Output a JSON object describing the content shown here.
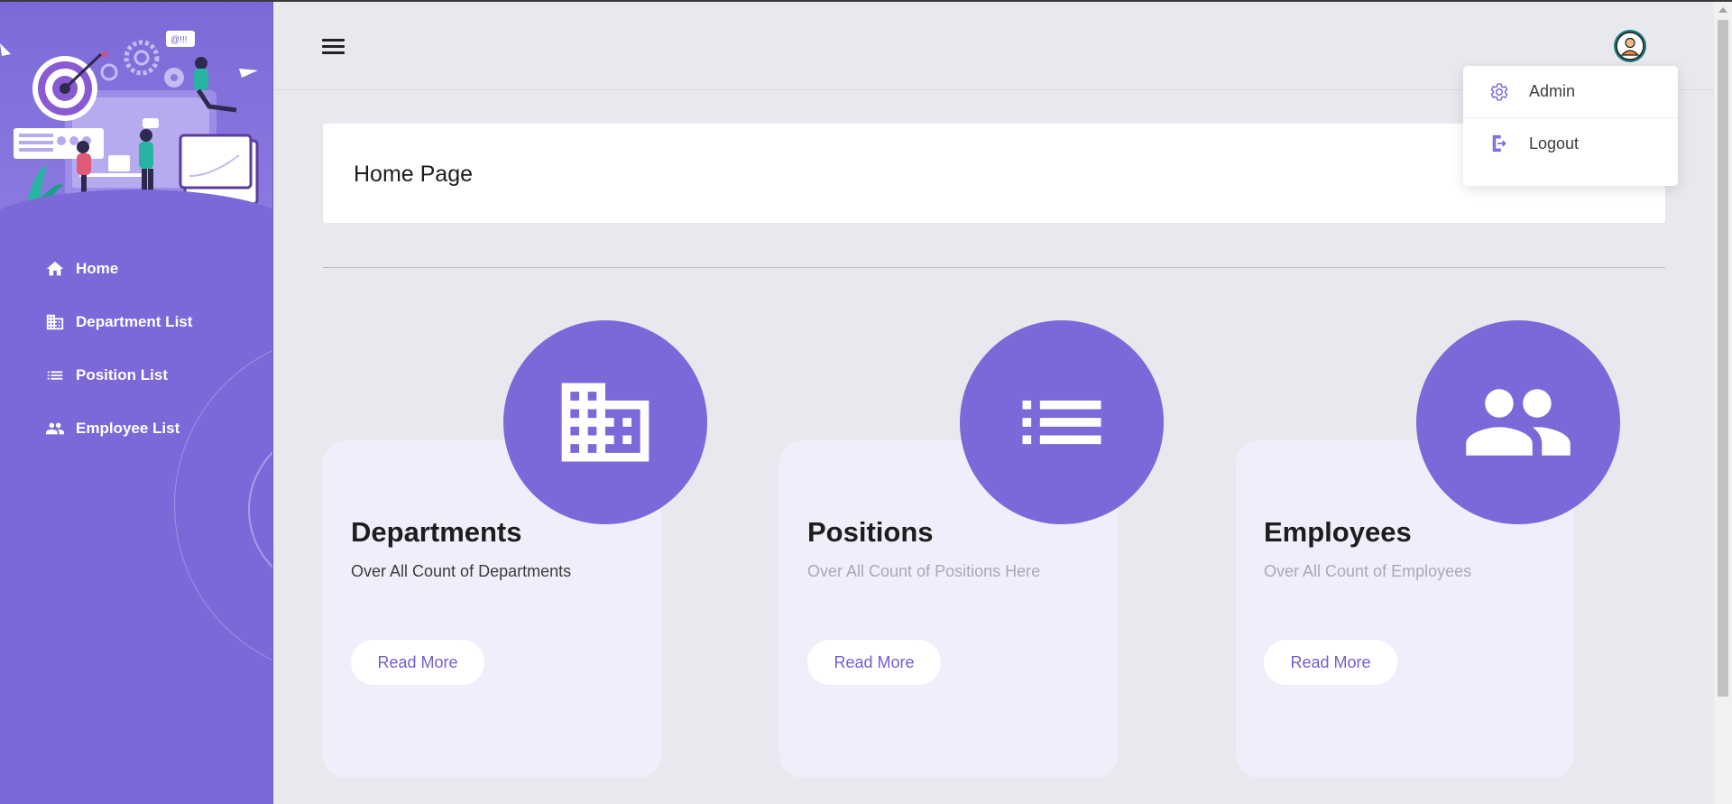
{
  "sidebar": {
    "items": [
      {
        "label": "Home",
        "icon": "home-icon"
      },
      {
        "label": "Department List",
        "icon": "building-icon"
      },
      {
        "label": "Position List",
        "icon": "list-icon"
      },
      {
        "label": "Employee List",
        "icon": "people-icon"
      }
    ]
  },
  "header": {
    "menu_icon": "hamburger-icon",
    "avatar_icon": "user-avatar-icon"
  },
  "user_menu": {
    "items": [
      {
        "label": "Admin",
        "icon": "gear-icon"
      },
      {
        "label": "Logout",
        "icon": "logout-icon"
      }
    ]
  },
  "main": {
    "page_title": "Home Page",
    "cards": [
      {
        "title": "Departments",
        "description": "Over All Count of Departments",
        "button": "Read More",
        "icon": "building-icon"
      },
      {
        "title": "Positions",
        "description": "Over All Count of Positions Here",
        "button": "Read More",
        "icon": "list-icon"
      },
      {
        "title": "Employees",
        "description": "Over All Count of Employees",
        "button": "Read More",
        "icon": "people-icon"
      }
    ]
  },
  "colors": {
    "accent": "#7b68d9",
    "background": "#e8e9ee",
    "card_background": "#efeffb"
  }
}
